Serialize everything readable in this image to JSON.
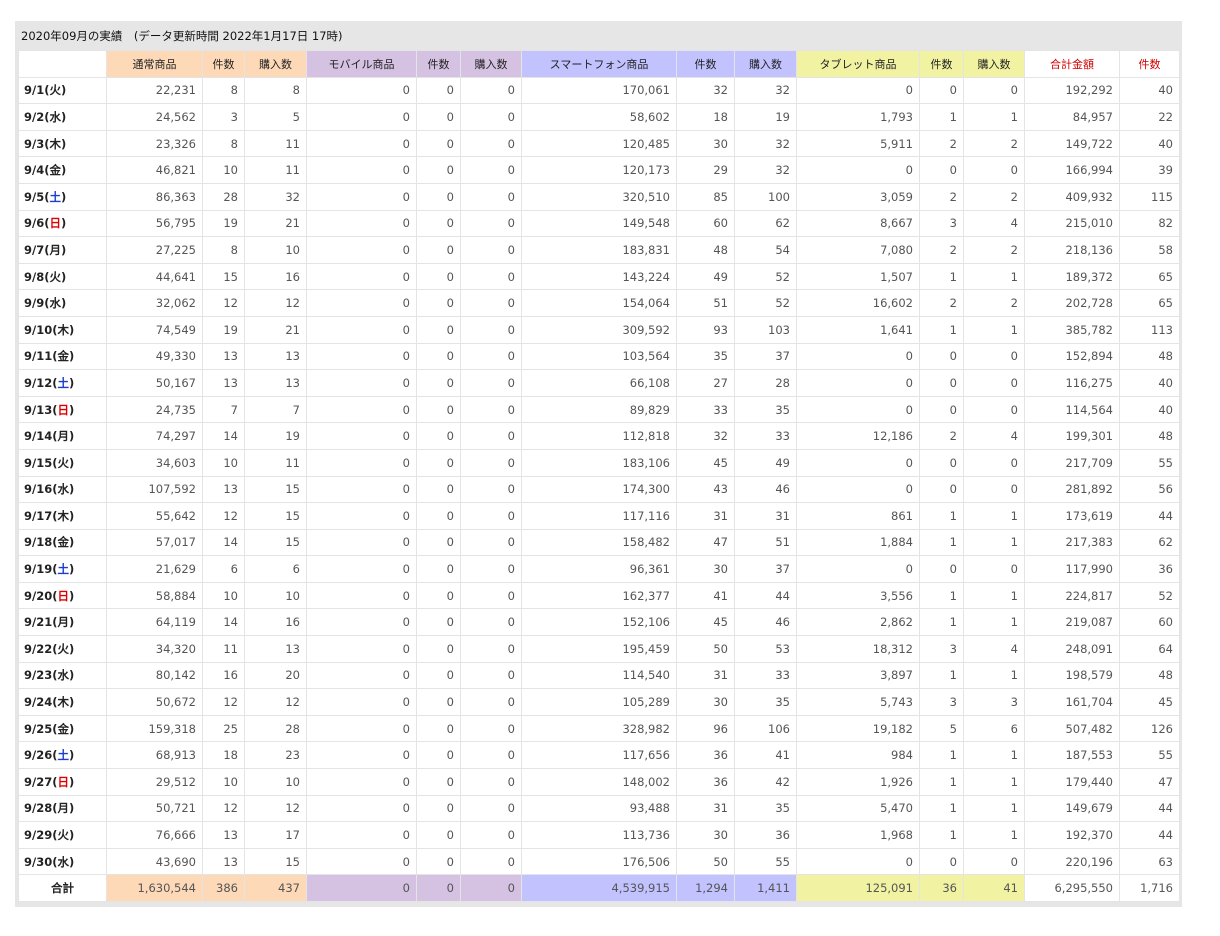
{
  "title": "2020年09月の実績　(データ更新時間 2022年1月17日 17時)",
  "headers": [
    "",
    "通常商品",
    "件数",
    "購入数",
    "モバイル商品",
    "件数",
    "購入数",
    "スマートフォン商品",
    "件数",
    "購入数",
    "タブレット商品",
    "件数",
    "購入数",
    "合計金額",
    "件数"
  ],
  "header_groups": [
    "blank",
    "normal",
    "normal",
    "normal",
    "mobile",
    "mobile",
    "mobile",
    "smart",
    "smart",
    "smart",
    "tablet",
    "tablet",
    "tablet",
    "sum",
    "sum"
  ],
  "colors": {
    "normal": "#fdd9b8",
    "mobile": "#d5c2e3",
    "smart": "#c2c2ff",
    "tablet": "#f1f3a2",
    "sum_header_text": "#d00000",
    "saturday": "#1a3ccf",
    "sunday": "#e00000"
  },
  "rows": [
    {
      "md": "9/1",
      "dow": "火",
      "type": "weekday",
      "values": [
        "22,231",
        "8",
        "8",
        "0",
        "0",
        "0",
        "170,061",
        "32",
        "32",
        "0",
        "0",
        "0",
        "192,292",
        "40"
      ]
    },
    {
      "md": "9/2",
      "dow": "水",
      "type": "weekday",
      "values": [
        "24,562",
        "3",
        "5",
        "0",
        "0",
        "0",
        "58,602",
        "18",
        "19",
        "1,793",
        "1",
        "1",
        "84,957",
        "22"
      ]
    },
    {
      "md": "9/3",
      "dow": "木",
      "type": "weekday",
      "values": [
        "23,326",
        "8",
        "11",
        "0",
        "0",
        "0",
        "120,485",
        "30",
        "32",
        "5,911",
        "2",
        "2",
        "149,722",
        "40"
      ]
    },
    {
      "md": "9/4",
      "dow": "金",
      "type": "weekday",
      "values": [
        "46,821",
        "10",
        "11",
        "0",
        "0",
        "0",
        "120,173",
        "29",
        "32",
        "0",
        "0",
        "0",
        "166,994",
        "39"
      ]
    },
    {
      "md": "9/5",
      "dow": "土",
      "type": "sat",
      "values": [
        "86,363",
        "28",
        "32",
        "0",
        "0",
        "0",
        "320,510",
        "85",
        "100",
        "3,059",
        "2",
        "2",
        "409,932",
        "115"
      ]
    },
    {
      "md": "9/6",
      "dow": "日",
      "type": "sun",
      "values": [
        "56,795",
        "19",
        "21",
        "0",
        "0",
        "0",
        "149,548",
        "60",
        "62",
        "8,667",
        "3",
        "4",
        "215,010",
        "82"
      ]
    },
    {
      "md": "9/7",
      "dow": "月",
      "type": "weekday",
      "values": [
        "27,225",
        "8",
        "10",
        "0",
        "0",
        "0",
        "183,831",
        "48",
        "54",
        "7,080",
        "2",
        "2",
        "218,136",
        "58"
      ]
    },
    {
      "md": "9/8",
      "dow": "火",
      "type": "weekday",
      "values": [
        "44,641",
        "15",
        "16",
        "0",
        "0",
        "0",
        "143,224",
        "49",
        "52",
        "1,507",
        "1",
        "1",
        "189,372",
        "65"
      ]
    },
    {
      "md": "9/9",
      "dow": "水",
      "type": "weekday",
      "values": [
        "32,062",
        "12",
        "12",
        "0",
        "0",
        "0",
        "154,064",
        "51",
        "52",
        "16,602",
        "2",
        "2",
        "202,728",
        "65"
      ]
    },
    {
      "md": "9/10",
      "dow": "木",
      "type": "weekday",
      "values": [
        "74,549",
        "19",
        "21",
        "0",
        "0",
        "0",
        "309,592",
        "93",
        "103",
        "1,641",
        "1",
        "1",
        "385,782",
        "113"
      ]
    },
    {
      "md": "9/11",
      "dow": "金",
      "type": "weekday",
      "values": [
        "49,330",
        "13",
        "13",
        "0",
        "0",
        "0",
        "103,564",
        "35",
        "37",
        "0",
        "0",
        "0",
        "152,894",
        "48"
      ]
    },
    {
      "md": "9/12",
      "dow": "土",
      "type": "sat",
      "values": [
        "50,167",
        "13",
        "13",
        "0",
        "0",
        "0",
        "66,108",
        "27",
        "28",
        "0",
        "0",
        "0",
        "116,275",
        "40"
      ]
    },
    {
      "md": "9/13",
      "dow": "日",
      "type": "sun",
      "values": [
        "24,735",
        "7",
        "7",
        "0",
        "0",
        "0",
        "89,829",
        "33",
        "35",
        "0",
        "0",
        "0",
        "114,564",
        "40"
      ]
    },
    {
      "md": "9/14",
      "dow": "月",
      "type": "weekday",
      "values": [
        "74,297",
        "14",
        "19",
        "0",
        "0",
        "0",
        "112,818",
        "32",
        "33",
        "12,186",
        "2",
        "4",
        "199,301",
        "48"
      ]
    },
    {
      "md": "9/15",
      "dow": "火",
      "type": "weekday",
      "values": [
        "34,603",
        "10",
        "11",
        "0",
        "0",
        "0",
        "183,106",
        "45",
        "49",
        "0",
        "0",
        "0",
        "217,709",
        "55"
      ]
    },
    {
      "md": "9/16",
      "dow": "水",
      "type": "weekday",
      "values": [
        "107,592",
        "13",
        "15",
        "0",
        "0",
        "0",
        "174,300",
        "43",
        "46",
        "0",
        "0",
        "0",
        "281,892",
        "56"
      ]
    },
    {
      "md": "9/17",
      "dow": "木",
      "type": "weekday",
      "values": [
        "55,642",
        "12",
        "15",
        "0",
        "0",
        "0",
        "117,116",
        "31",
        "31",
        "861",
        "1",
        "1",
        "173,619",
        "44"
      ]
    },
    {
      "md": "9/18",
      "dow": "金",
      "type": "weekday",
      "values": [
        "57,017",
        "14",
        "15",
        "0",
        "0",
        "0",
        "158,482",
        "47",
        "51",
        "1,884",
        "1",
        "1",
        "217,383",
        "62"
      ]
    },
    {
      "md": "9/19",
      "dow": "土",
      "type": "sat",
      "values": [
        "21,629",
        "6",
        "6",
        "0",
        "0",
        "0",
        "96,361",
        "30",
        "37",
        "0",
        "0",
        "0",
        "117,990",
        "36"
      ]
    },
    {
      "md": "9/20",
      "dow": "日",
      "type": "sun",
      "values": [
        "58,884",
        "10",
        "10",
        "0",
        "0",
        "0",
        "162,377",
        "41",
        "44",
        "3,556",
        "1",
        "1",
        "224,817",
        "52"
      ]
    },
    {
      "md": "9/21",
      "dow": "月",
      "type": "weekday",
      "values": [
        "64,119",
        "14",
        "16",
        "0",
        "0",
        "0",
        "152,106",
        "45",
        "46",
        "2,862",
        "1",
        "1",
        "219,087",
        "60"
      ]
    },
    {
      "md": "9/22",
      "dow": "火",
      "type": "weekday",
      "values": [
        "34,320",
        "11",
        "13",
        "0",
        "0",
        "0",
        "195,459",
        "50",
        "53",
        "18,312",
        "3",
        "4",
        "248,091",
        "64"
      ]
    },
    {
      "md": "9/23",
      "dow": "水",
      "type": "weekday",
      "values": [
        "80,142",
        "16",
        "20",
        "0",
        "0",
        "0",
        "114,540",
        "31",
        "33",
        "3,897",
        "1",
        "1",
        "198,579",
        "48"
      ]
    },
    {
      "md": "9/24",
      "dow": "木",
      "type": "weekday",
      "values": [
        "50,672",
        "12",
        "12",
        "0",
        "0",
        "0",
        "105,289",
        "30",
        "35",
        "5,743",
        "3",
        "3",
        "161,704",
        "45"
      ]
    },
    {
      "md": "9/25",
      "dow": "金",
      "type": "weekday",
      "values": [
        "159,318",
        "25",
        "28",
        "0",
        "0",
        "0",
        "328,982",
        "96",
        "106",
        "19,182",
        "5",
        "6",
        "507,482",
        "126"
      ]
    },
    {
      "md": "9/26",
      "dow": "土",
      "type": "sat",
      "values": [
        "68,913",
        "18",
        "23",
        "0",
        "0",
        "0",
        "117,656",
        "36",
        "41",
        "984",
        "1",
        "1",
        "187,553",
        "55"
      ]
    },
    {
      "md": "9/27",
      "dow": "日",
      "type": "sun",
      "values": [
        "29,512",
        "10",
        "10",
        "0",
        "0",
        "0",
        "148,002",
        "36",
        "42",
        "1,926",
        "1",
        "1",
        "179,440",
        "47"
      ]
    },
    {
      "md": "9/28",
      "dow": "月",
      "type": "weekday",
      "values": [
        "50,721",
        "12",
        "12",
        "0",
        "0",
        "0",
        "93,488",
        "31",
        "35",
        "5,470",
        "1",
        "1",
        "149,679",
        "44"
      ]
    },
    {
      "md": "9/29",
      "dow": "火",
      "type": "weekday",
      "values": [
        "76,666",
        "13",
        "17",
        "0",
        "0",
        "0",
        "113,736",
        "30",
        "36",
        "1,968",
        "1",
        "1",
        "192,370",
        "44"
      ]
    },
    {
      "md": "9/30",
      "dow": "水",
      "type": "weekday",
      "values": [
        "43,690",
        "13",
        "15",
        "0",
        "0",
        "0",
        "176,506",
        "50",
        "55",
        "0",
        "0",
        "0",
        "220,196",
        "63"
      ]
    }
  ],
  "total": {
    "label": "合計",
    "values": [
      "1,630,544",
      "386",
      "437",
      "0",
      "0",
      "0",
      "4,539,915",
      "1,294",
      "1,411",
      "125,091",
      "36",
      "41",
      "6,295,550",
      "1,716"
    ]
  }
}
